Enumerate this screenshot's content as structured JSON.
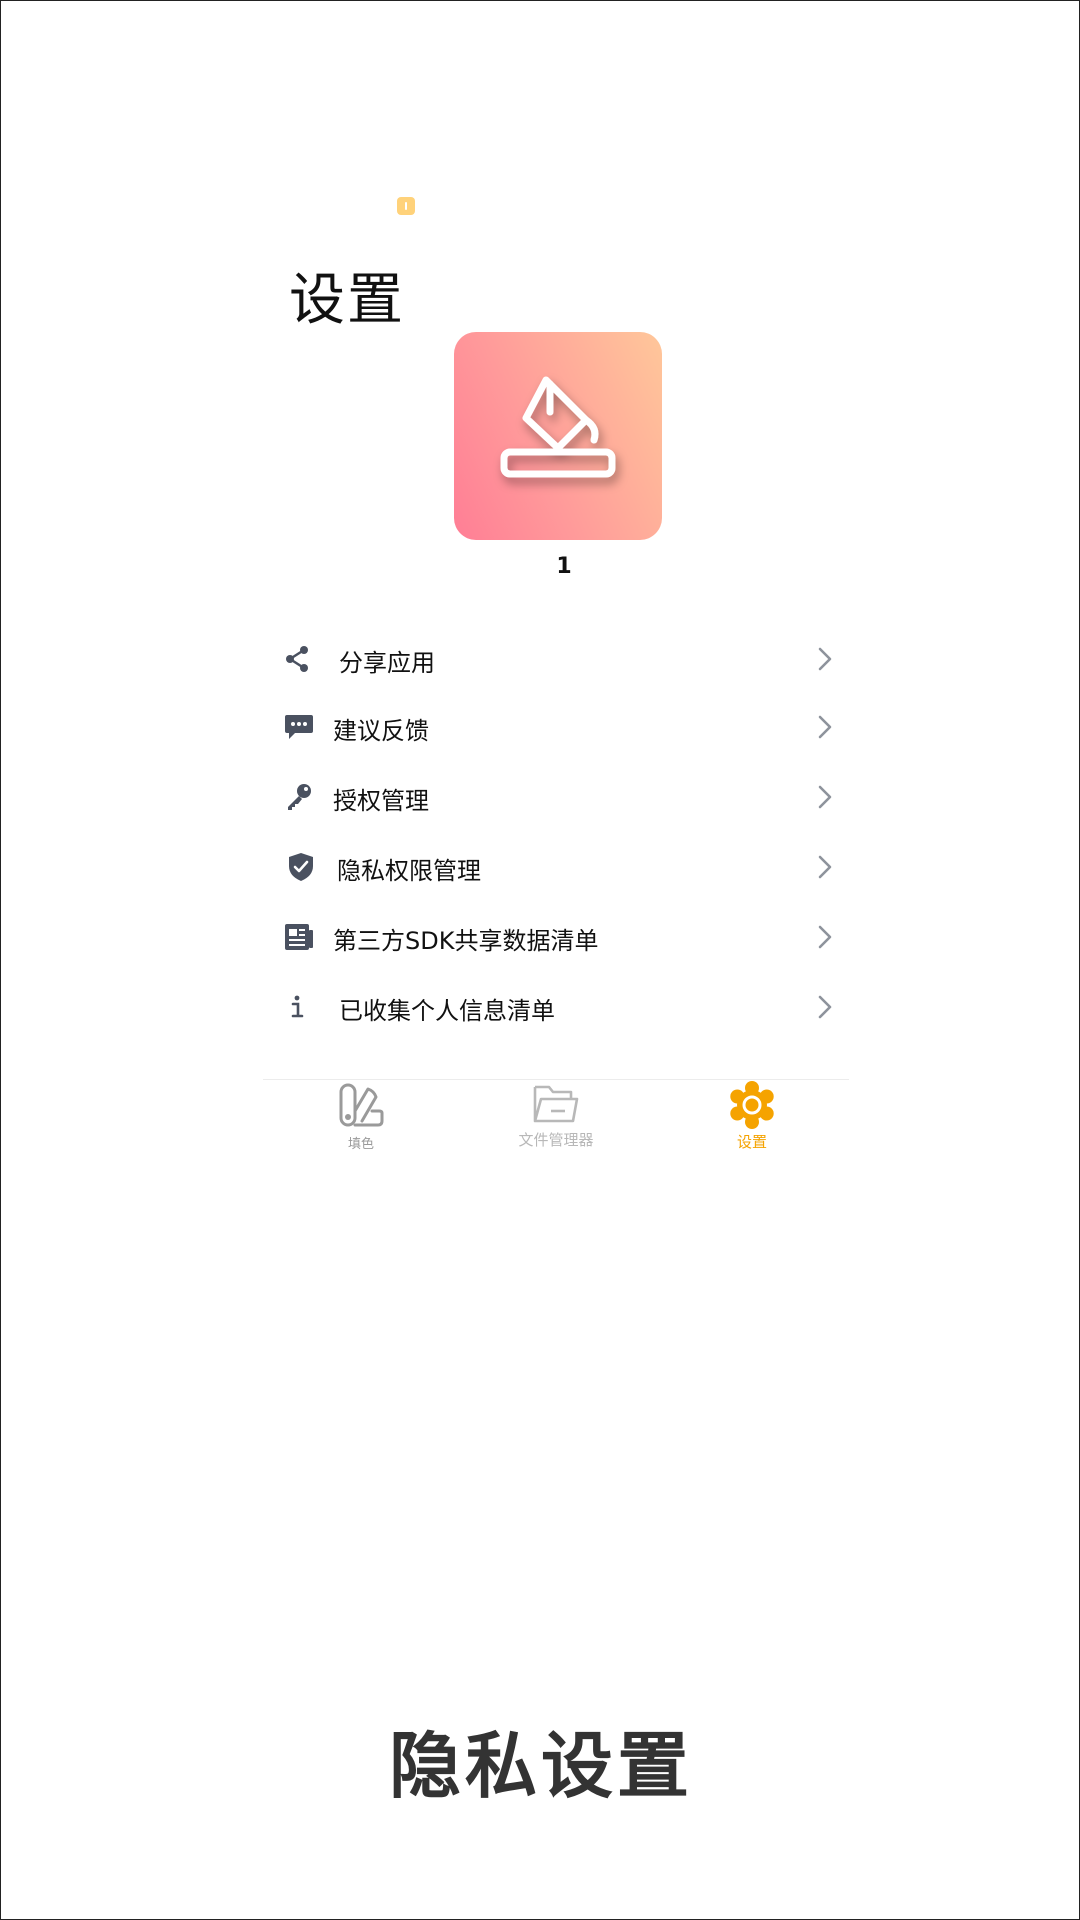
{
  "header": {
    "title": "设置"
  },
  "app": {
    "name": "1",
    "logo_gradient": [
      "#ff7e95",
      "#ffc79a"
    ]
  },
  "menu": {
    "items": [
      {
        "label": "分享应用",
        "icon": "share-icon"
      },
      {
        "label": "建议反馈",
        "icon": "chat-bubble-icon"
      },
      {
        "label": "授权管理",
        "icon": "key-icon"
      },
      {
        "label": "隐私权限管理",
        "icon": "shield-check-icon"
      },
      {
        "label": "第三方SDK共享数据清单",
        "icon": "document-list-icon"
      },
      {
        "label": "已收集个人信息清单",
        "icon": "info-icon"
      }
    ]
  },
  "tabbar": {
    "tabs": [
      {
        "label": "填色",
        "icon": "palette-icon",
        "active": false
      },
      {
        "label": "文件管理器",
        "icon": "folder-icon",
        "active": false
      },
      {
        "label": "设置",
        "icon": "gear-icon",
        "active": true
      }
    ],
    "active_color": "#f5a300",
    "inactive_color": "#9a9a9a"
  },
  "caption": {
    "text": "隐私设置"
  },
  "colors": {
    "icon": "#4a5160",
    "chevron": "#8e939c"
  }
}
